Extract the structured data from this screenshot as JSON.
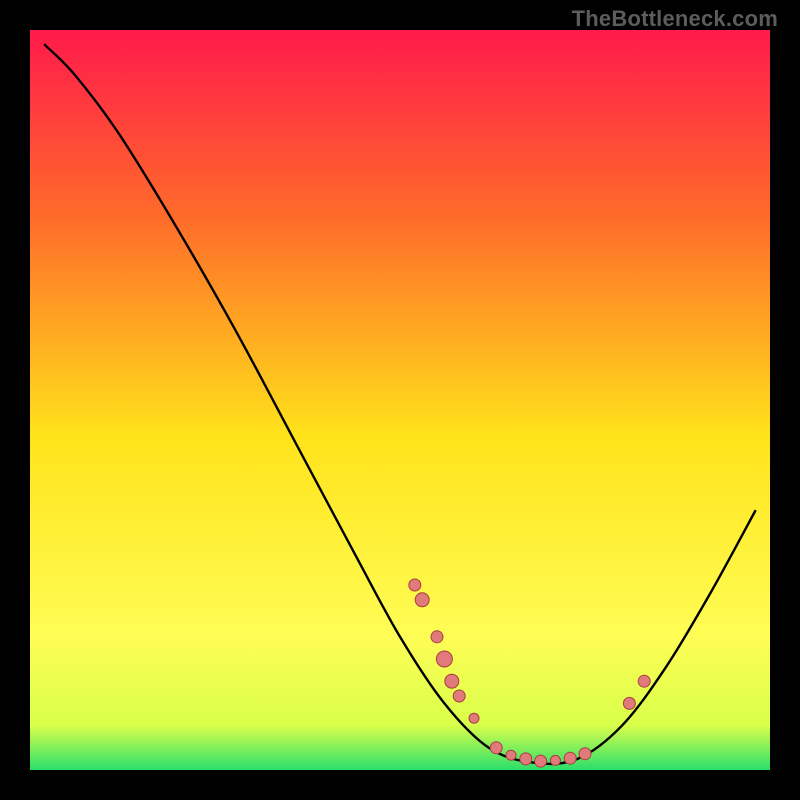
{
  "watermark": "TheBottleneck.com",
  "colors": {
    "marker_fill": "#e17a7a",
    "marker_stroke": "#a83f3f",
    "curve": "#000000",
    "gradient": [
      "#ff1a4b",
      "#ff6a2a",
      "#ffe31a",
      "#fffd55",
      "#d8ff4a",
      "#2bdf6b"
    ]
  },
  "chart_data": {
    "type": "line",
    "title": "",
    "xlabel": "",
    "ylabel": "",
    "xlim": [
      0,
      100
    ],
    "ylim": [
      0,
      100
    ],
    "curve": [
      {
        "x": 2,
        "y": 98
      },
      {
        "x": 6,
        "y": 94
      },
      {
        "x": 12,
        "y": 86
      },
      {
        "x": 20,
        "y": 73
      },
      {
        "x": 28,
        "y": 59
      },
      {
        "x": 36,
        "y": 44
      },
      {
        "x": 44,
        "y": 29
      },
      {
        "x": 50,
        "y": 18
      },
      {
        "x": 56,
        "y": 9
      },
      {
        "x": 62,
        "y": 3
      },
      {
        "x": 68,
        "y": 1
      },
      {
        "x": 74,
        "y": 1.5
      },
      {
        "x": 80,
        "y": 6
      },
      {
        "x": 86,
        "y": 14
      },
      {
        "x": 92,
        "y": 24
      },
      {
        "x": 98,
        "y": 35
      }
    ],
    "markers": [
      {
        "x": 52,
        "y": 25,
        "r": 6
      },
      {
        "x": 53,
        "y": 23,
        "r": 7
      },
      {
        "x": 55,
        "y": 18,
        "r": 6
      },
      {
        "x": 56,
        "y": 15,
        "r": 8
      },
      {
        "x": 57,
        "y": 12,
        "r": 7
      },
      {
        "x": 58,
        "y": 10,
        "r": 6
      },
      {
        "x": 60,
        "y": 7,
        "r": 5
      },
      {
        "x": 63,
        "y": 3,
        "r": 6
      },
      {
        "x": 65,
        "y": 2,
        "r": 5
      },
      {
        "x": 67,
        "y": 1.5,
        "r": 6
      },
      {
        "x": 69,
        "y": 1.2,
        "r": 6
      },
      {
        "x": 71,
        "y": 1.3,
        "r": 5
      },
      {
        "x": 73,
        "y": 1.6,
        "r": 6
      },
      {
        "x": 75,
        "y": 2.2,
        "r": 6
      },
      {
        "x": 81,
        "y": 9,
        "r": 6
      },
      {
        "x": 83,
        "y": 12,
        "r": 6
      }
    ]
  }
}
